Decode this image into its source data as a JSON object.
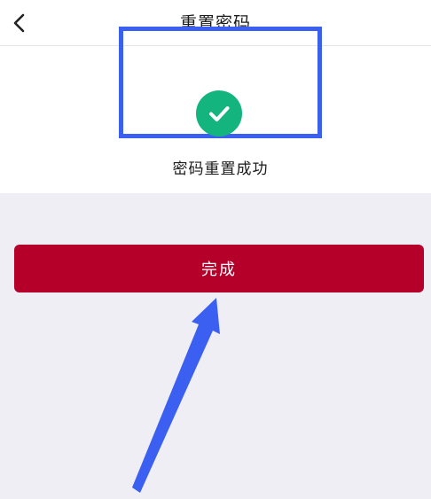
{
  "header": {
    "title": "重置密码",
    "back_icon": "chevron-left-icon"
  },
  "success": {
    "message": "密码重置成功",
    "status_icon": "check-circle-icon",
    "icon_color": "#14b47f",
    "highlight_color": "#3b5ff0"
  },
  "actions": {
    "done_label": "完成",
    "done_color": "#b5002a"
  },
  "annotation": {
    "arrow_icon": "pointer-arrow-icon",
    "arrow_color": "#3b5ff0"
  }
}
